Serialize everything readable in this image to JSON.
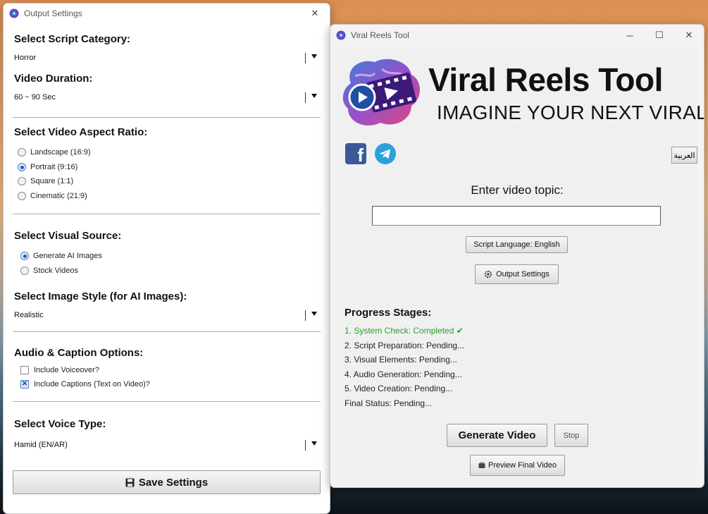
{
  "settings_window": {
    "title": "Output Settings",
    "script_category": {
      "label": "Select Script Category:",
      "value": "Horror"
    },
    "video_duration": {
      "label": "Video Duration:",
      "value": "60 ~ 90 Sec"
    },
    "aspect_ratio": {
      "label": "Select Video Aspect Ratio:",
      "options": [
        "Landscape (16:9)",
        "Portrait (9:16)",
        "Square (1:1)",
        "Cinematic (21:9)"
      ],
      "selected": "Portrait (9:16)"
    },
    "visual_source": {
      "label": "Select Visual Source:",
      "options": [
        "Generate AI Images",
        "Stock Videos"
      ],
      "selected": "Generate AI Images"
    },
    "image_style": {
      "label": "Select Image Style (for AI Images):",
      "value": "Realistic"
    },
    "audio_caption": {
      "label": "Audio & Caption Options:",
      "voiceover": {
        "label": "Include Voiceover?",
        "checked": false
      },
      "captions": {
        "label": "Include Captions (Text on Video)?",
        "checked": true,
        "mark": "✕"
      }
    },
    "voice_type": {
      "label": "Select Voice Type:",
      "value": "Hamid (EN/AR)"
    },
    "save_label": "Save Settings"
  },
  "main_window": {
    "title": "Viral Reels Tool",
    "logo_title": "Viral Reels Tool",
    "logo_tagline": "IMAGINE YOUR NEXT VIRAL",
    "arabic_button": "العربية",
    "topic_label": "Enter video topic:",
    "topic_value": "",
    "script_language_button": "Script Language: English",
    "output_settings_button": "Output Settings",
    "progress_title": "Progress Stages:",
    "stages": [
      "1. System Check: Completed ✔",
      "2. Script Preparation: Pending...",
      "3. Visual Elements: Pending...",
      "4. Audio Generation: Pending...",
      "5. Video Creation: Pending...",
      "Final Status: Pending..."
    ],
    "generate_button": "Generate Video",
    "stop_button": "Stop",
    "preview_button": "Preview Final Video"
  },
  "colors": {
    "completed": "#2ca02c",
    "facebook": "#3b5998",
    "telegram": "#2aa1da"
  },
  "icons": [
    "app-logo-icon",
    "close-icon",
    "minimize-icon",
    "maximize-icon",
    "facebook-icon",
    "telegram-icon",
    "gear-icon",
    "save-icon",
    "preview-icon",
    "dropdown-arrow-icon"
  ]
}
